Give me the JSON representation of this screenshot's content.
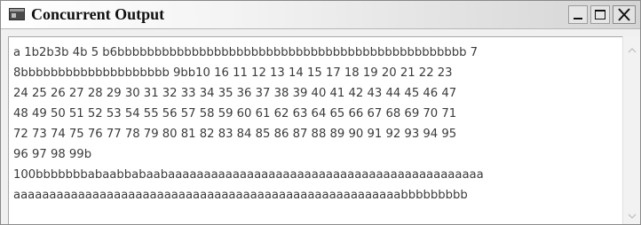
{
  "window": {
    "title": "Concurrent Output",
    "icons": {
      "app": "app-window-icon",
      "minimize": "minimize-icon",
      "maximize": "maximize-icon",
      "close": "close-icon",
      "scroll_up": "chevron-up-icon",
      "scroll_down": "chevron-down-icon"
    }
  },
  "output": {
    "lines": [
      "a 1b2b3b 4b 5 b6bbbbbbbbbbbbbbbbbbbbbbbbbbbbbbbbbbbbbbbbbbbbbbb 7",
      "8bbbbbbbbbbbbbbbbbbbb 9bb10 16 11 12 13 14 15 17 18 19 20 21 22 23",
      "24 25 26 27 28 29 30 31 32 33 34 35 36 37 38 39 40 41 42 43 44 45 46 47",
      "48 49 50 51 52 53 54 55 56 57 58 59 60 61 62 63 64 65 66 67 68 69 70 71",
      "72 73 74 75 76 77 78 79 80 81 82 83 84 85 86 87 88 89 90 91 92 93 94 95",
      "96 97 98 99b",
      "100bbbbbbbabaabbabaabaaaaaaaaaaaaaaaaaaaaaaaaaaaaaaaaaaaaaaaaaaaa",
      "aaaaaaaaaaaaaaaaaaaaaaaaaaaaaaaaaaaaaaaaaaaaaaaaaaaaaabbbbbbbbb"
    ]
  }
}
